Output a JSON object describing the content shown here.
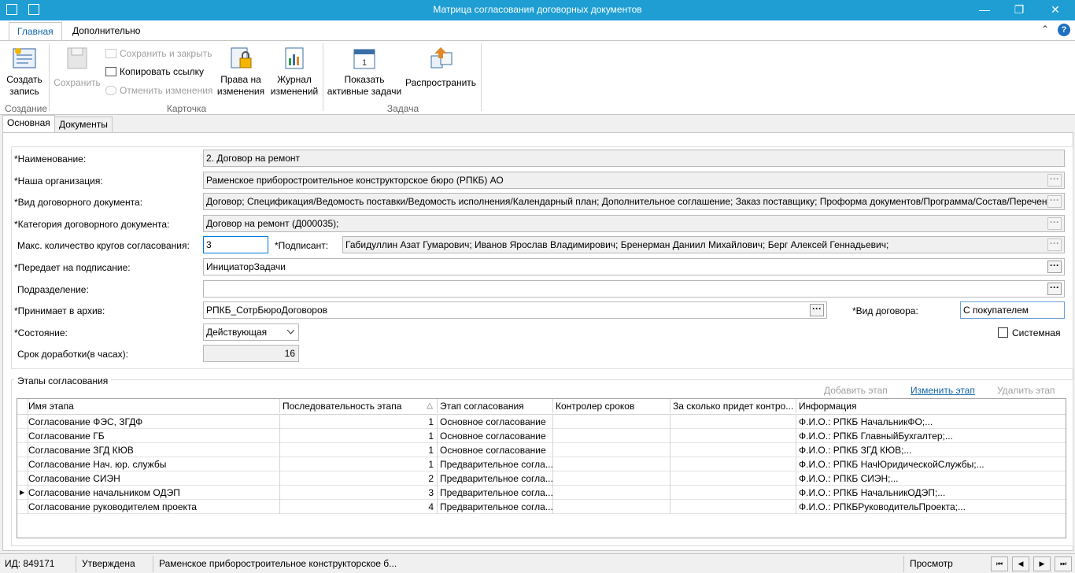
{
  "window": {
    "title": "Матрица согласования договорных документов",
    "buttons": {
      "minimize": "—",
      "restore": "❐",
      "close": "✕"
    }
  },
  "ribbon": {
    "tabs": [
      "Главная",
      "Дополнительно"
    ],
    "collapse": "⌃",
    "help": "?",
    "create": {
      "line1": "Создать",
      "line2": "запись",
      "group": "Создание"
    },
    "save": "Сохранить",
    "save_close": "Сохранить и закрыть",
    "copy_link": "Копировать ссылку",
    "cancel_changes": "Отменить изменения",
    "card_group": "Карточка",
    "rights": {
      "line1": "Права на",
      "line2": "изменения"
    },
    "journal": {
      "line1": "Журнал",
      "line2": "изменений"
    },
    "show_tasks": {
      "line1": "Показать",
      "line2": "активные задачи"
    },
    "distribute": "Распространить",
    "task_group": "Задача"
  },
  "page_tabs": [
    "Основная",
    "Документы"
  ],
  "form": {
    "name": {
      "label": "*Наименование:",
      "value": "2. Договор на ремонт"
    },
    "org": {
      "label": "*Наша организация:",
      "value": "Раменское приборостроительное конструкторское бюро (РПКБ) АО"
    },
    "doc_type": {
      "label": "*Вид договорного документа:",
      "value": "Договор; Спецификация/Ведомость поставки/Ведомость исполнения/Календарный план; Дополнительное соглашение; Заказ поставщику; Проформа документов/Программа/Состав/Перечень"
    },
    "category": {
      "label": "*Категория договорного документа:",
      "value": "Договор на ремонт (Д000035);"
    },
    "max_rounds": {
      "label": "Макс. количество кругов согласования:",
      "value": "3"
    },
    "signer": {
      "label": "*Подписант:",
      "value": "Габидуллин Азат Гумарович; Иванов Ярослав Владимирович; Бренерман Даниил Михайлович; Берг Алексей Геннадьевич;"
    },
    "transfer": {
      "label": "*Передает на подписание:",
      "value": "ИнициаторЗадачи"
    },
    "department": {
      "label": "Подразделение:",
      "value": ""
    },
    "archive": {
      "label": "*Принимает в архив:",
      "value": "РПКБ_СотрБюроДоговоров"
    },
    "contract_kind": {
      "label": "*Вид договора:",
      "value": "С покупателем"
    },
    "state": {
      "label": "*Состояние:",
      "value": "Действующая"
    },
    "system": {
      "label": "Системная"
    },
    "rework": {
      "label": "Срок доработки(в часах):",
      "value": "16"
    },
    "dots": "···"
  },
  "stages": {
    "title": "Этапы согласования",
    "add": "Добавить этап",
    "edit": "Изменить этап",
    "delete": "Удалить этап",
    "columns": [
      "Имя этапа",
      "Последовательность этапа",
      "Этап согласования",
      "Контролер сроков",
      "За сколько придет контро...",
      "Информация"
    ],
    "sort_icon": "△",
    "current_marker": "▶",
    "rows": [
      {
        "name": "Согласование ФЭС, ЗГДФ",
        "seq": "1",
        "stage": "Основное согласование",
        "ctrl": "",
        "before": "",
        "info": "Ф.И.О.: РПКБ НачальникФО;..."
      },
      {
        "name": "Согласование ГБ",
        "seq": "1",
        "stage": "Основное согласование",
        "ctrl": "",
        "before": "",
        "info": "Ф.И.О.: РПКБ ГлавныйБухгалтер;..."
      },
      {
        "name": "Согласование ЗГД КЮВ",
        "seq": "1",
        "stage": "Основное согласование",
        "ctrl": "",
        "before": "",
        "info": "Ф.И.О.: РПКБ ЗГД КЮВ;..."
      },
      {
        "name": "Согласование Нач. юр. службы",
        "seq": "1",
        "stage": "Предварительное согла...",
        "ctrl": "",
        "before": "",
        "info": "Ф.И.О.: РПКБ НачЮридическойСлужбы;..."
      },
      {
        "name": "Согласование СИЭН",
        "seq": "2",
        "stage": "Предварительное согла...",
        "ctrl": "",
        "before": "",
        "info": "Ф.И.О.: РПКБ СИЭН;..."
      },
      {
        "name": "Согласование начальником ОДЭП",
        "seq": "3",
        "stage": "Предварительное согла...",
        "ctrl": "",
        "before": "",
        "info": "Ф.И.О.: РПКБ НачальникОДЭП;..."
      },
      {
        "name": "Согласование руководителем проекта",
        "seq": "4",
        "stage": "Предварительное согла...",
        "ctrl": "",
        "before": "",
        "info": "Ф.И.О.: РПКБРуководительПроекта;..."
      }
    ]
  },
  "status": {
    "id": "ИД: 849171",
    "state": "Утверждена",
    "org": "Раменское приборостроительное конструкторское б...",
    "mode": "Просмотр",
    "nav": [
      "⏮",
      "◀",
      "▶",
      "⏭"
    ]
  }
}
